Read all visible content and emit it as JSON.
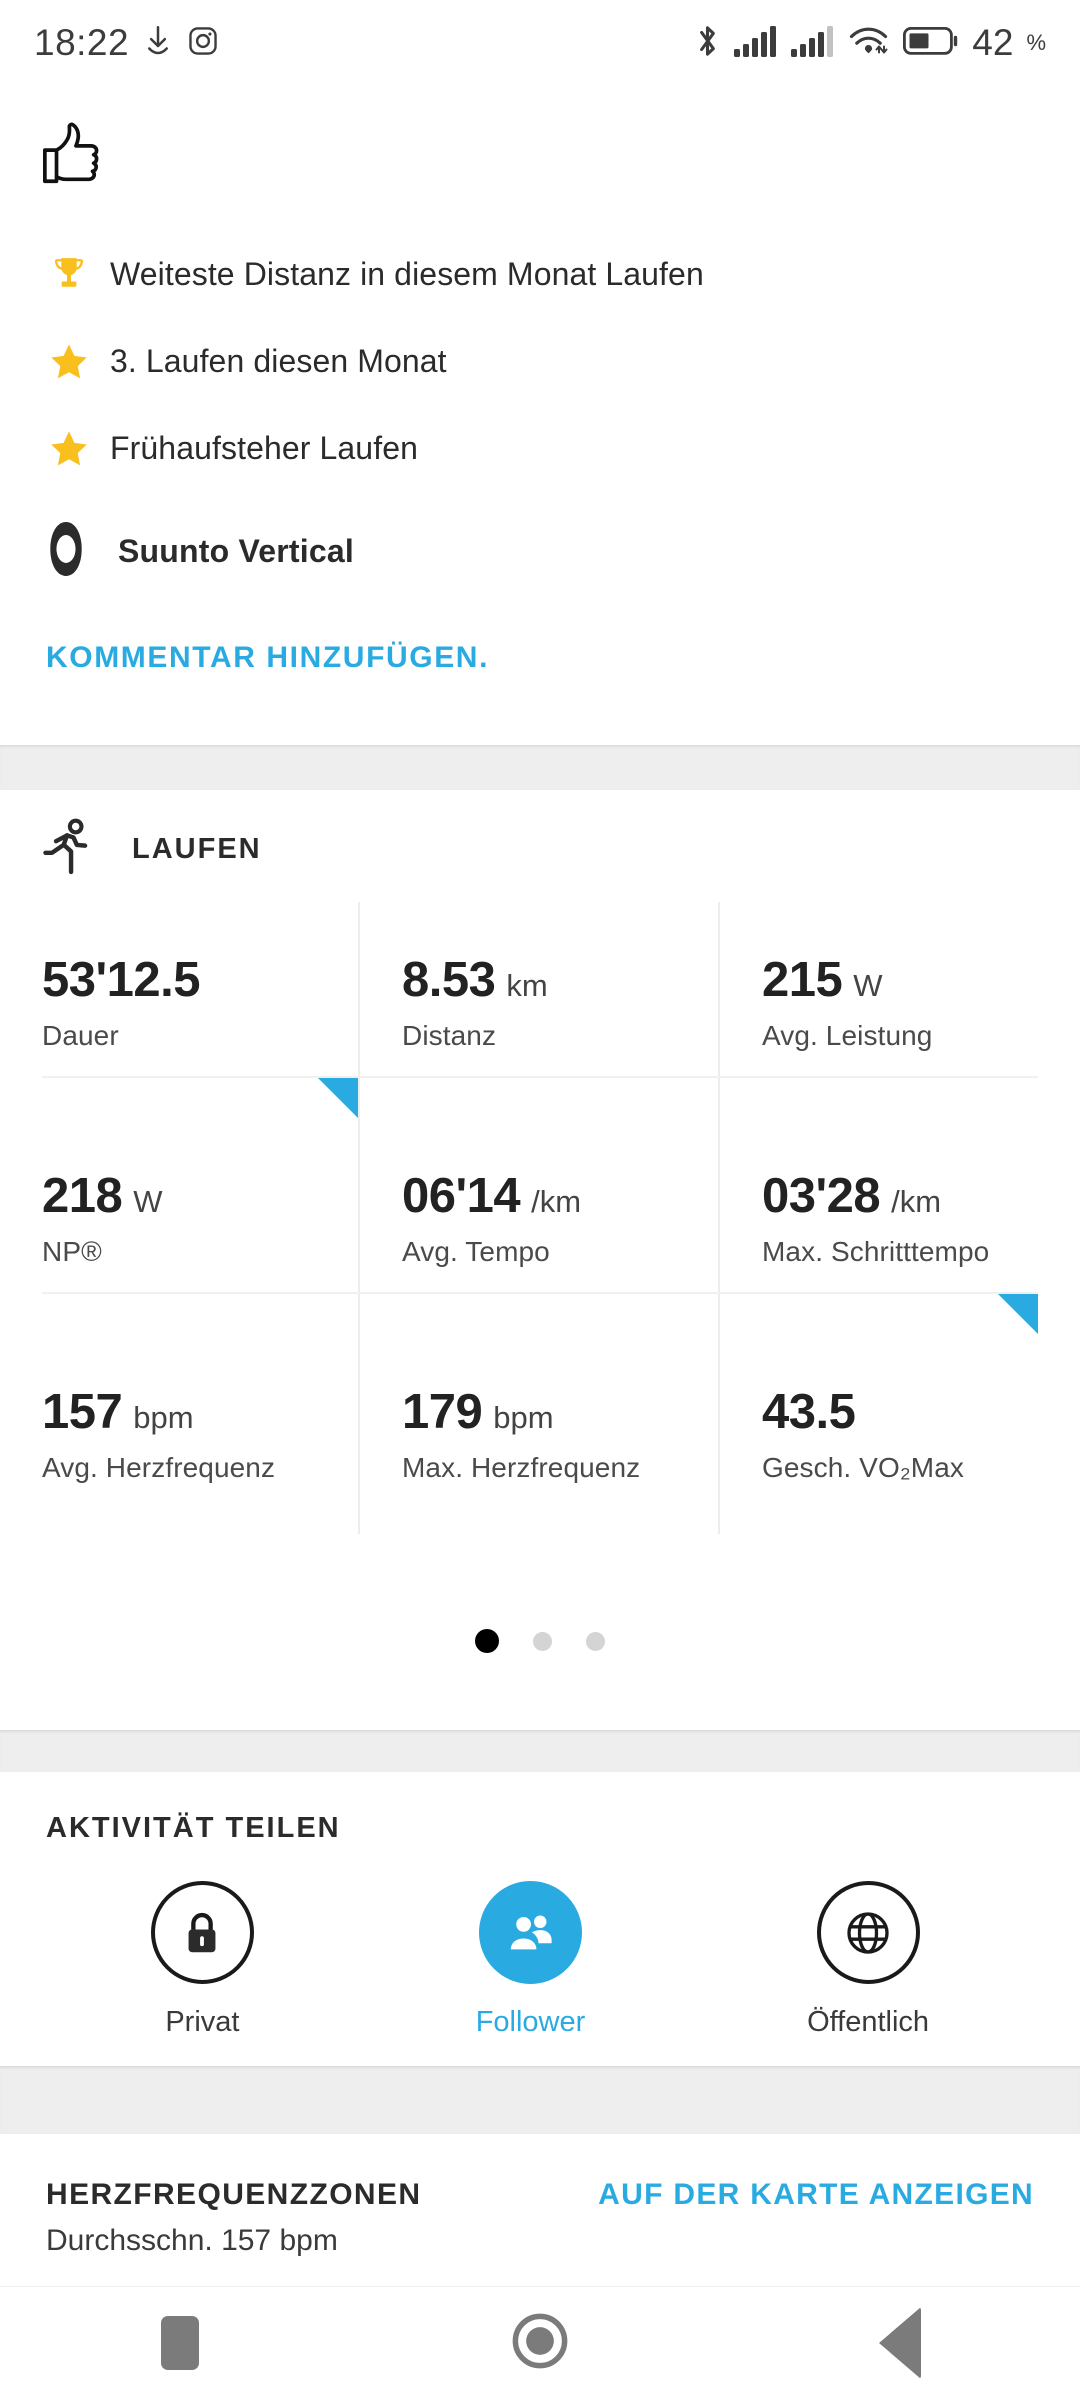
{
  "statusbar": {
    "time": "18:22",
    "battery_percent": "42",
    "percent_symbol": "%",
    "icons": [
      "download-icon",
      "instagram-icon",
      "bluetooth-icon",
      "cellular-signal-1-icon",
      "cellular-signal-2-icon",
      "wifi-icon",
      "battery-icon"
    ]
  },
  "social": {
    "reaction_icon": "thumbs-up-icon",
    "achievements": [
      {
        "icon": "trophy-icon",
        "label": "Weiteste Distanz in diesem Monat Laufen"
      },
      {
        "icon": "star-icon",
        "label": "3. Laufen diesen Monat"
      },
      {
        "icon": "star-icon",
        "label": "Frühaufsteher Laufen"
      }
    ],
    "device": {
      "icon": "watch-icon",
      "name": "Suunto Vertical"
    },
    "comment_link": "KOMMENTAR HINZUFÜGEN."
  },
  "activity": {
    "icon": "running-icon",
    "title": "LAUFEN",
    "stats": [
      {
        "value": "53'12.5",
        "unit": "",
        "label": "Dauer",
        "marker": false
      },
      {
        "value": "8.53",
        "unit": "km",
        "label": "Distanz",
        "marker": false
      },
      {
        "value": "215",
        "unit": "W",
        "label": "Avg. Leistung",
        "marker": false
      },
      {
        "value": "218",
        "unit": "W",
        "label": "NP®",
        "marker": true
      },
      {
        "value": "06'14",
        "unit": "/km",
        "label": "Avg. Tempo",
        "marker": false
      },
      {
        "value": "03'28",
        "unit": "/km",
        "label": "Max. Schritttempo",
        "marker": false
      },
      {
        "value": "157",
        "unit": "bpm",
        "label": "Avg. Herzfrequenz",
        "marker": false
      },
      {
        "value": "179",
        "unit": "bpm",
        "label": "Max. Herzfrequenz",
        "marker": false
      },
      {
        "value": "43.5",
        "unit": "",
        "label": "Gesch. VO₂Max",
        "marker": true
      }
    ],
    "pagination": {
      "total": 3,
      "active_index": 0
    }
  },
  "share": {
    "title": "AKTIVITÄT TEILEN",
    "options": [
      {
        "icon": "lock-icon",
        "label": "Privat",
        "selected": false
      },
      {
        "icon": "people-icon",
        "label": "Follower",
        "selected": true
      },
      {
        "icon": "globe-icon",
        "label": "Öffentlich",
        "selected": false
      }
    ]
  },
  "heart_rate_zones": {
    "title": "HERZFREQUENZZONEN",
    "subtitle": "Durchsschn. 157 bpm",
    "map_link": "AUF DER KARTE ANZEIGEN"
  },
  "navbar": {
    "buttons": [
      {
        "icon": "recents-square-icon",
        "label": "Recents"
      },
      {
        "icon": "home-circle-icon",
        "label": "Home"
      },
      {
        "icon": "back-triangle-icon",
        "label": "Back"
      }
    ]
  },
  "colors": {
    "accent": "#29abe2",
    "gold": "#f9bf1c",
    "text_primary": "#222222",
    "text_secondary": "#4a4a4a",
    "separator": "#eeeeee"
  }
}
